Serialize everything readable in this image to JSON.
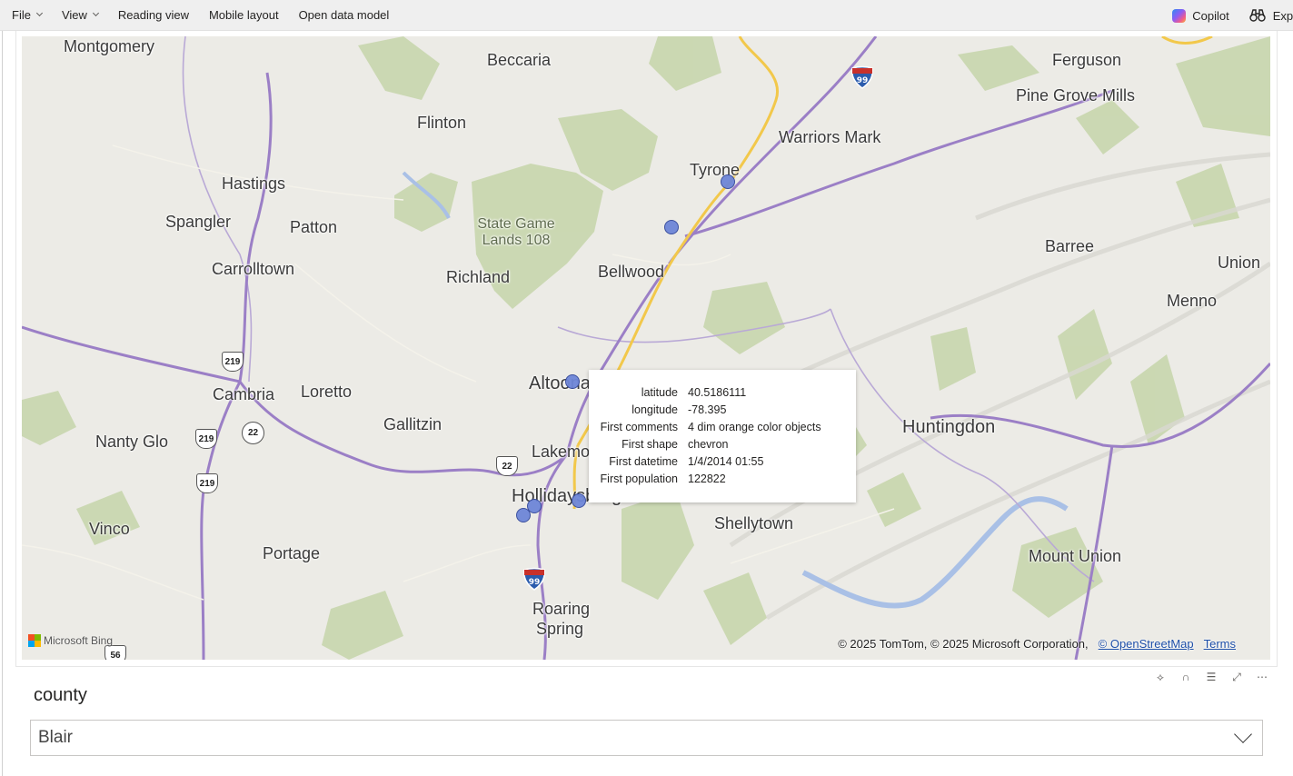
{
  "menubar": {
    "items": [
      {
        "label": "File",
        "has_dropdown": true
      },
      {
        "label": "View",
        "has_dropdown": true
      },
      {
        "label": "Reading view",
        "has_dropdown": false
      },
      {
        "label": "Mobile layout",
        "has_dropdown": false
      },
      {
        "label": "Open data model",
        "has_dropdown": false
      }
    ],
    "copilot_label": "Copilot",
    "explore_label": "Expl"
  },
  "map": {
    "places": {
      "montgomery": "Montgomery",
      "beccaria": "Beccaria",
      "ferguson": "Ferguson",
      "pine_grove_mills": "Pine Grove Mills",
      "flinton": "Flinton",
      "warriors_mark": "Warriors Mark",
      "hastings": "Hastings",
      "tyrone": "Tyrone",
      "spangler": "Spangler",
      "patton": "Patton",
      "state_game_lands": "State Game Lands 108",
      "barree": "Barree",
      "union": "Union",
      "carrolltown": "Carrolltown",
      "richland": "Richland",
      "bellwood": "Bellwood",
      "menno": "Menno",
      "cambria": "Cambria",
      "loretto": "Loretto",
      "altoona": "Altoona",
      "huntingdon": "Huntingdon",
      "nanty_glo": "Nanty Glo",
      "gallitzin": "Gallitzin",
      "lakemont": "Lakemont",
      "hollidaysburg": "Hollidaysburg",
      "shellytown": "Shellytown",
      "vinco": "Vinco",
      "portage": "Portage",
      "mount_union": "Mount Union",
      "roaring_spring": "Roaring Spring"
    },
    "shields": {
      "i99": "99",
      "us219": "219",
      "us22": "22",
      "us56": "56"
    },
    "bing_label": "Microsoft Bing",
    "attribution": "© 2025 TomTom, © 2025 Microsoft Corporation,",
    "osm_link": "© OpenStreetMap",
    "terms_link": "Terms"
  },
  "tooltip": {
    "rows": [
      {
        "key": "latitude",
        "value": "40.5186111"
      },
      {
        "key": "longitude",
        "value": "-78.395"
      },
      {
        "key": "First comments",
        "value": "4 dim orange color objects"
      },
      {
        "key": "First shape",
        "value": "chevron"
      },
      {
        "key": "First datetime",
        "value": "1/4/2014 01:55"
      },
      {
        "key": "First population",
        "value": "122822"
      }
    ]
  },
  "visual_header": {
    "icons": [
      "pin-icon",
      "spotlight-icon",
      "filter-icon",
      "focus-mode-icon",
      "more-options-icon"
    ]
  },
  "slicer": {
    "title": "county",
    "selected_value": "Blair"
  },
  "colors": {
    "marker_fill": "#6e86d8",
    "marker_stroke": "#34499b",
    "interstate_road": "#f2c84b",
    "us_route": "#9b7fc6",
    "forest": "#c3d3a8"
  }
}
